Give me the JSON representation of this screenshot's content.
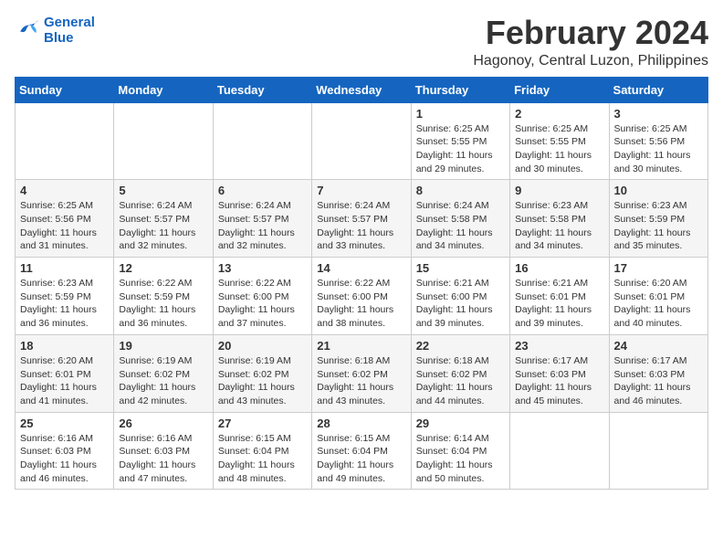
{
  "logo": {
    "line1": "General",
    "line2": "Blue"
  },
  "title": "February 2024",
  "location": "Hagonoy, Central Luzon, Philippines",
  "days_of_week": [
    "Sunday",
    "Monday",
    "Tuesday",
    "Wednesday",
    "Thursday",
    "Friday",
    "Saturday"
  ],
  "weeks": [
    [
      {
        "day": "",
        "info": ""
      },
      {
        "day": "",
        "info": ""
      },
      {
        "day": "",
        "info": ""
      },
      {
        "day": "",
        "info": ""
      },
      {
        "day": "1",
        "info": "Sunrise: 6:25 AM\nSunset: 5:55 PM\nDaylight: 11 hours and 29 minutes."
      },
      {
        "day": "2",
        "info": "Sunrise: 6:25 AM\nSunset: 5:55 PM\nDaylight: 11 hours and 30 minutes."
      },
      {
        "day": "3",
        "info": "Sunrise: 6:25 AM\nSunset: 5:56 PM\nDaylight: 11 hours and 30 minutes."
      }
    ],
    [
      {
        "day": "4",
        "info": "Sunrise: 6:25 AM\nSunset: 5:56 PM\nDaylight: 11 hours and 31 minutes."
      },
      {
        "day": "5",
        "info": "Sunrise: 6:24 AM\nSunset: 5:57 PM\nDaylight: 11 hours and 32 minutes."
      },
      {
        "day": "6",
        "info": "Sunrise: 6:24 AM\nSunset: 5:57 PM\nDaylight: 11 hours and 32 minutes."
      },
      {
        "day": "7",
        "info": "Sunrise: 6:24 AM\nSunset: 5:57 PM\nDaylight: 11 hours and 33 minutes."
      },
      {
        "day": "8",
        "info": "Sunrise: 6:24 AM\nSunset: 5:58 PM\nDaylight: 11 hours and 34 minutes."
      },
      {
        "day": "9",
        "info": "Sunrise: 6:23 AM\nSunset: 5:58 PM\nDaylight: 11 hours and 34 minutes."
      },
      {
        "day": "10",
        "info": "Sunrise: 6:23 AM\nSunset: 5:59 PM\nDaylight: 11 hours and 35 minutes."
      }
    ],
    [
      {
        "day": "11",
        "info": "Sunrise: 6:23 AM\nSunset: 5:59 PM\nDaylight: 11 hours and 36 minutes."
      },
      {
        "day": "12",
        "info": "Sunrise: 6:22 AM\nSunset: 5:59 PM\nDaylight: 11 hours and 36 minutes."
      },
      {
        "day": "13",
        "info": "Sunrise: 6:22 AM\nSunset: 6:00 PM\nDaylight: 11 hours and 37 minutes."
      },
      {
        "day": "14",
        "info": "Sunrise: 6:22 AM\nSunset: 6:00 PM\nDaylight: 11 hours and 38 minutes."
      },
      {
        "day": "15",
        "info": "Sunrise: 6:21 AM\nSunset: 6:00 PM\nDaylight: 11 hours and 39 minutes."
      },
      {
        "day": "16",
        "info": "Sunrise: 6:21 AM\nSunset: 6:01 PM\nDaylight: 11 hours and 39 minutes."
      },
      {
        "day": "17",
        "info": "Sunrise: 6:20 AM\nSunset: 6:01 PM\nDaylight: 11 hours and 40 minutes."
      }
    ],
    [
      {
        "day": "18",
        "info": "Sunrise: 6:20 AM\nSunset: 6:01 PM\nDaylight: 11 hours and 41 minutes."
      },
      {
        "day": "19",
        "info": "Sunrise: 6:19 AM\nSunset: 6:02 PM\nDaylight: 11 hours and 42 minutes."
      },
      {
        "day": "20",
        "info": "Sunrise: 6:19 AM\nSunset: 6:02 PM\nDaylight: 11 hours and 43 minutes."
      },
      {
        "day": "21",
        "info": "Sunrise: 6:18 AM\nSunset: 6:02 PM\nDaylight: 11 hours and 43 minutes."
      },
      {
        "day": "22",
        "info": "Sunrise: 6:18 AM\nSunset: 6:02 PM\nDaylight: 11 hours and 44 minutes."
      },
      {
        "day": "23",
        "info": "Sunrise: 6:17 AM\nSunset: 6:03 PM\nDaylight: 11 hours and 45 minutes."
      },
      {
        "day": "24",
        "info": "Sunrise: 6:17 AM\nSunset: 6:03 PM\nDaylight: 11 hours and 46 minutes."
      }
    ],
    [
      {
        "day": "25",
        "info": "Sunrise: 6:16 AM\nSunset: 6:03 PM\nDaylight: 11 hours and 46 minutes."
      },
      {
        "day": "26",
        "info": "Sunrise: 6:16 AM\nSunset: 6:03 PM\nDaylight: 11 hours and 47 minutes."
      },
      {
        "day": "27",
        "info": "Sunrise: 6:15 AM\nSunset: 6:04 PM\nDaylight: 11 hours and 48 minutes."
      },
      {
        "day": "28",
        "info": "Sunrise: 6:15 AM\nSunset: 6:04 PM\nDaylight: 11 hours and 49 minutes."
      },
      {
        "day": "29",
        "info": "Sunrise: 6:14 AM\nSunset: 6:04 PM\nDaylight: 11 hours and 50 minutes."
      },
      {
        "day": "",
        "info": ""
      },
      {
        "day": "",
        "info": ""
      }
    ]
  ]
}
